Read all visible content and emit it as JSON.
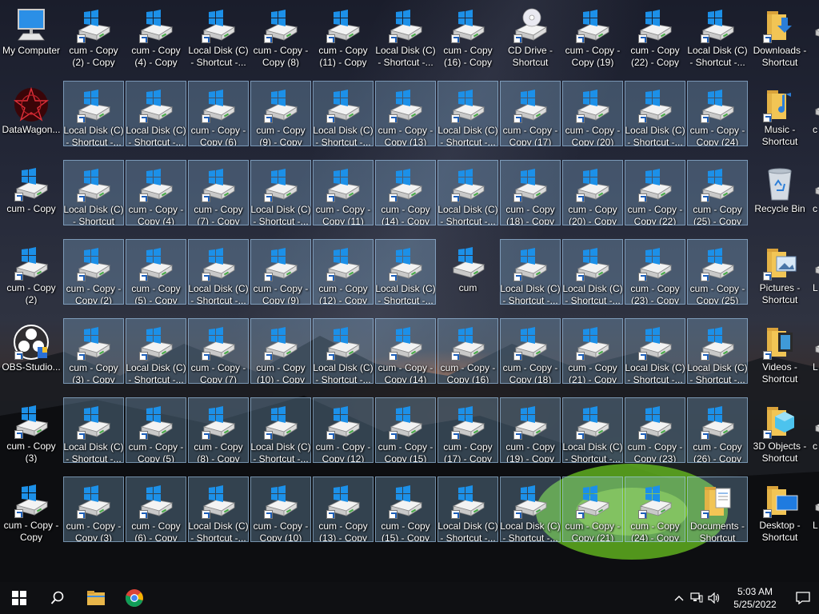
{
  "desktop": {
    "left_column": [
      {
        "label": "My Computer",
        "icon": "computer-icon",
        "shortcut": false
      },
      {
        "label": "DataWagon...",
        "icon": "datawagon-app-icon",
        "shortcut": false
      },
      {
        "label": "cum - Copy",
        "icon": "drive-icon",
        "shortcut": true
      },
      {
        "label": "cum - Copy (2)",
        "icon": "drive-icon",
        "shortcut": true
      },
      {
        "label": "OBS-Studio...",
        "icon": "obs-studio-icon",
        "shortcut": true
      },
      {
        "label": "cum - Copy (3)",
        "icon": "drive-icon",
        "shortcut": true
      },
      {
        "label": "cum - Copy - Copy",
        "icon": "drive-icon",
        "shortcut": true
      }
    ],
    "grid_rows": [
      [
        {
          "label": "cum - Copy (2) - Copy",
          "icon": "drive-icon",
          "shortcut": true,
          "selected": false
        },
        {
          "label": "cum - Copy (4) - Copy",
          "icon": "drive-icon",
          "shortcut": true,
          "selected": false
        },
        {
          "label": "Local Disk (C) - Shortcut -...",
          "icon": "drive-icon",
          "shortcut": true,
          "selected": false
        },
        {
          "label": "cum - Copy - Copy (8)",
          "icon": "drive-icon",
          "shortcut": true,
          "selected": false
        },
        {
          "label": "cum - Copy (11) - Copy",
          "icon": "drive-icon",
          "shortcut": true,
          "selected": false
        },
        {
          "label": "Local Disk (C) - Shortcut -...",
          "icon": "drive-icon",
          "shortcut": true,
          "selected": false
        },
        {
          "label": "cum - Copy (16) - Copy",
          "icon": "drive-icon",
          "shortcut": true,
          "selected": false
        },
        {
          "label": "CD Drive - Shortcut",
          "icon": "cd-drive-icon",
          "shortcut": true,
          "selected": false
        },
        {
          "label": "cum - Copy - Copy (19)",
          "icon": "drive-icon",
          "shortcut": true,
          "selected": false
        },
        {
          "label": "cum - Copy (22) - Copy",
          "icon": "drive-icon",
          "shortcut": true,
          "selected": false
        },
        {
          "label": "Local Disk (C) - Shortcut -...",
          "icon": "drive-icon",
          "shortcut": true,
          "selected": false
        }
      ],
      [
        {
          "label": "Local Disk (C) - Shortcut -...",
          "icon": "drive-icon",
          "shortcut": true,
          "selected": true
        },
        {
          "label": "Local Disk (C) - Shortcut -...",
          "icon": "drive-icon",
          "shortcut": true,
          "selected": true
        },
        {
          "label": "cum - Copy - Copy (6)",
          "icon": "drive-icon",
          "shortcut": true,
          "selected": true
        },
        {
          "label": "cum - Copy (9) - Copy",
          "icon": "drive-icon",
          "shortcut": true,
          "selected": true
        },
        {
          "label": "Local Disk (C) - Shortcut -...",
          "icon": "drive-icon",
          "shortcut": true,
          "selected": true
        },
        {
          "label": "cum - Copy - Copy (13)",
          "icon": "drive-icon",
          "shortcut": true,
          "selected": true
        },
        {
          "label": "Local Disk (C) - Shortcut -...",
          "icon": "drive-icon",
          "shortcut": true,
          "selected": true
        },
        {
          "label": "cum - Copy - Copy (17)",
          "icon": "drive-icon",
          "shortcut": true,
          "selected": true
        },
        {
          "label": "cum - Copy - Copy (20)",
          "icon": "drive-icon",
          "shortcut": true,
          "selected": true
        },
        {
          "label": "Local Disk (C) - Shortcut -...",
          "icon": "drive-icon",
          "shortcut": true,
          "selected": true
        },
        {
          "label": "cum - Copy - Copy (24)",
          "icon": "drive-icon",
          "shortcut": true,
          "selected": true
        }
      ],
      [
        {
          "label": "Local Disk (C) - Shortcut",
          "icon": "drive-icon",
          "shortcut": true,
          "selected": true
        },
        {
          "label": "cum - Copy - Copy (4)",
          "icon": "drive-icon",
          "shortcut": true,
          "selected": true
        },
        {
          "label": "cum - Copy (7) - Copy",
          "icon": "drive-icon",
          "shortcut": true,
          "selected": true
        },
        {
          "label": "Local Disk (C) - Shortcut -...",
          "icon": "drive-icon",
          "shortcut": true,
          "selected": true
        },
        {
          "label": "cum - Copy - Copy (11)",
          "icon": "drive-icon",
          "shortcut": true,
          "selected": true
        },
        {
          "label": "cum - Copy (14) - Copy",
          "icon": "drive-icon",
          "shortcut": true,
          "selected": true
        },
        {
          "label": "Local Disk (C) - Shortcut -...",
          "icon": "drive-icon",
          "shortcut": true,
          "selected": true
        },
        {
          "label": "cum - Copy (18) - Copy",
          "icon": "drive-icon",
          "shortcut": true,
          "selected": true
        },
        {
          "label": "cum - Copy (20) - Copy",
          "icon": "drive-icon",
          "shortcut": true,
          "selected": true
        },
        {
          "label": "cum - Copy - Copy (22)",
          "icon": "drive-icon",
          "shortcut": true,
          "selected": true
        },
        {
          "label": "cum - Copy (25) - Copy",
          "icon": "drive-icon",
          "shortcut": true,
          "selected": true
        }
      ],
      [
        {
          "label": "cum - Copy - Copy (2)",
          "icon": "drive-icon",
          "shortcut": true,
          "selected": true
        },
        {
          "label": "cum - Copy (5) - Copy",
          "icon": "drive-icon",
          "shortcut": true,
          "selected": true
        },
        {
          "label": "Local Disk (C) - Shortcut -...",
          "icon": "drive-icon",
          "shortcut": true,
          "selected": true
        },
        {
          "label": "cum - Copy - Copy (9)",
          "icon": "drive-icon",
          "shortcut": true,
          "selected": true
        },
        {
          "label": "cum - Copy (12) - Copy",
          "icon": "drive-icon",
          "shortcut": true,
          "selected": true
        },
        {
          "label": "Local Disk (C) - Shortcut -...",
          "icon": "drive-icon",
          "shortcut": true,
          "selected": true
        },
        {
          "label": "cum",
          "icon": "drive-icon",
          "shortcut": false,
          "selected": false
        },
        {
          "label": "Local Disk (C) - Shortcut -...",
          "icon": "drive-icon",
          "shortcut": true,
          "selected": true
        },
        {
          "label": "Local Disk (C) - Shortcut -...",
          "icon": "drive-icon",
          "shortcut": true,
          "selected": true
        },
        {
          "label": "cum - Copy (23) - Copy",
          "icon": "drive-icon",
          "shortcut": true,
          "selected": true
        },
        {
          "label": "cum - Copy - Copy (25)",
          "icon": "drive-icon",
          "shortcut": true,
          "selected": true
        }
      ],
      [
        {
          "label": "cum - Copy (3) - Copy",
          "icon": "drive-icon",
          "shortcut": true,
          "selected": true
        },
        {
          "label": "Local Disk (C) - Shortcut -...",
          "icon": "drive-icon",
          "shortcut": true,
          "selected": true
        },
        {
          "label": "cum - Copy - Copy (7)",
          "icon": "drive-icon",
          "shortcut": true,
          "selected": true
        },
        {
          "label": "cum - Copy (10) - Copy",
          "icon": "drive-icon",
          "shortcut": true,
          "selected": true
        },
        {
          "label": "Local Disk (C) - Shortcut -...",
          "icon": "drive-icon",
          "shortcut": true,
          "selected": true
        },
        {
          "label": "cum - Copy - Copy (14)",
          "icon": "drive-icon",
          "shortcut": true,
          "selected": true
        },
        {
          "label": "cum - Copy - Copy (16)",
          "icon": "drive-icon",
          "shortcut": true,
          "selected": true
        },
        {
          "label": "cum - Copy - Copy (18)",
          "icon": "drive-icon",
          "shortcut": true,
          "selected": true
        },
        {
          "label": "cum - Copy (21) - Copy",
          "icon": "drive-icon",
          "shortcut": true,
          "selected": true
        },
        {
          "label": "Local Disk (C) - Shortcut -...",
          "icon": "drive-icon",
          "shortcut": true,
          "selected": true
        },
        {
          "label": "Local Disk (C) - Shortcut -...",
          "icon": "drive-icon",
          "shortcut": true,
          "selected": true
        }
      ],
      [
        {
          "label": "Local Disk (C) - Shortcut -...",
          "icon": "drive-icon",
          "shortcut": true,
          "selected": true
        },
        {
          "label": "cum - Copy - Copy (5)",
          "icon": "drive-icon",
          "shortcut": true,
          "selected": true
        },
        {
          "label": "cum - Copy (8) - Copy",
          "icon": "drive-icon",
          "shortcut": true,
          "selected": true
        },
        {
          "label": "Local Disk (C) - Shortcut -...",
          "icon": "drive-icon",
          "shortcut": true,
          "selected": true
        },
        {
          "label": "cum - Copy - Copy (12)",
          "icon": "drive-icon",
          "shortcut": true,
          "selected": true
        },
        {
          "label": "cum - Copy - Copy (15)",
          "icon": "drive-icon",
          "shortcut": true,
          "selected": true
        },
        {
          "label": "cum - Copy (17) - Copy",
          "icon": "drive-icon",
          "shortcut": true,
          "selected": true
        },
        {
          "label": "cum - Copy (19) - Copy",
          "icon": "drive-icon",
          "shortcut": true,
          "selected": true
        },
        {
          "label": "Local Disk (C) - Shortcut -...",
          "icon": "drive-icon",
          "shortcut": true,
          "selected": true
        },
        {
          "label": "cum - Copy - Copy (23)",
          "icon": "drive-icon",
          "shortcut": true,
          "selected": true
        },
        {
          "label": "cum - Copy (26) - Copy",
          "icon": "drive-icon",
          "shortcut": true,
          "selected": true
        }
      ],
      [
        {
          "label": "cum - Copy - Copy (3)",
          "icon": "drive-icon",
          "shortcut": true,
          "selected": true
        },
        {
          "label": "cum - Copy (6) - Copy",
          "icon": "drive-icon",
          "shortcut": true,
          "selected": true
        },
        {
          "label": "Local Disk (C) - Shortcut -...",
          "icon": "drive-icon",
          "shortcut": true,
          "selected": true
        },
        {
          "label": "cum - Copy - Copy (10)",
          "icon": "drive-icon",
          "shortcut": true,
          "selected": true
        },
        {
          "label": "cum - Copy (13) - Copy",
          "icon": "drive-icon",
          "shortcut": true,
          "selected": true
        },
        {
          "label": "cum - Copy (15) - Copy",
          "icon": "drive-icon",
          "shortcut": true,
          "selected": true
        },
        {
          "label": "Local Disk (C) - Shortcut -...",
          "icon": "drive-icon",
          "shortcut": true,
          "selected": true
        },
        {
          "label": "Local Disk (C) - Shortcut -...",
          "icon": "drive-icon",
          "shortcut": true,
          "selected": true
        },
        {
          "label": "cum - Copy - Copy (21)",
          "icon": "drive-icon",
          "shortcut": true,
          "selected": true
        },
        {
          "label": "cum - Copy (24) - Copy",
          "icon": "drive-icon",
          "shortcut": true,
          "selected": true
        },
        {
          "label": "Documents - Shortcut",
          "icon": "documents-folder-icon",
          "shortcut": true,
          "selected": true
        }
      ]
    ],
    "right_column": [
      {
        "label": "Downloads - Shortcut",
        "icon": "downloads-folder-icon",
        "shortcut": true
      },
      {
        "label": "Music - Shortcut",
        "icon": "music-folder-icon",
        "shortcut": true
      },
      {
        "label": "Recycle Bin",
        "icon": "recycle-bin-icon",
        "shortcut": false
      },
      {
        "label": "Pictures - Shortcut",
        "icon": "pictures-folder-icon",
        "shortcut": true
      },
      {
        "label": "Videos - Shortcut",
        "icon": "videos-folder-icon",
        "shortcut": true
      },
      {
        "label": "3D Objects - Shortcut",
        "icon": "3d-objects-folder-icon",
        "shortcut": true
      },
      {
        "label": "Desktop - Shortcut",
        "icon": "desktop-folder-icon",
        "shortcut": true
      }
    ],
    "edge_column": [
      {
        "label": "",
        "icon": "drive-icon"
      },
      {
        "label": "c",
        "icon": "drive-icon"
      },
      {
        "label": "c",
        "icon": "drive-icon"
      },
      {
        "label": "L",
        "icon": "drive-icon"
      },
      {
        "label": "L",
        "icon": "drive-icon"
      },
      {
        "label": "c",
        "icon": "drive-icon"
      },
      {
        "label": "L",
        "icon": "drive-icon"
      }
    ]
  },
  "taskbar": {
    "start": "start-windows-icon",
    "search": "search-icon",
    "apps": [
      "file-explorer-icon",
      "chrome-icon"
    ],
    "clock": {
      "time": "5:03 AM",
      "date": "5/25/2022"
    },
    "tray": [
      "chevron-up-icon",
      "network-icon",
      "volume-icon",
      "notifications-icon"
    ]
  },
  "colors": {
    "selection_fill": "#96c8f0",
    "taskbar_bg": "#0f1013",
    "drive_blue": "#1c90e8"
  }
}
